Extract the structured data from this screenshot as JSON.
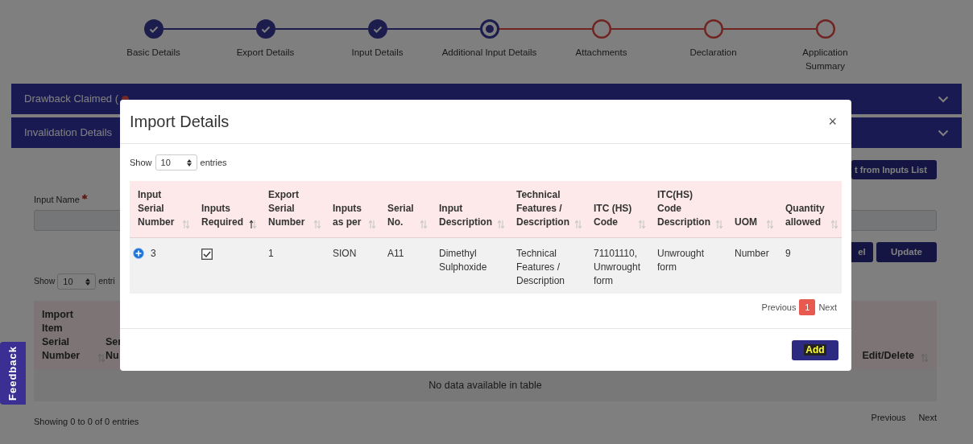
{
  "stepper": [
    {
      "label": "Basic Details",
      "completed": true,
      "current": false
    },
    {
      "label": "Export Details",
      "completed": true,
      "current": false
    },
    {
      "label": "Input Details",
      "completed": true,
      "current": false
    },
    {
      "label": "Additional Input Details",
      "completed": false,
      "current": true
    },
    {
      "label": "Attachments",
      "completed": false,
      "current": false
    },
    {
      "label": "Declaration",
      "completed": false,
      "current": false
    },
    {
      "label": "Application Summary",
      "completed": false,
      "current": false
    }
  ],
  "accordions": [
    {
      "title": "Drawback Claimed (",
      "info_icon": true
    },
    {
      "title": "Invalidation Details",
      "info_icon": false
    }
  ],
  "form": {
    "select_button": "t from Inputs List",
    "input_label": "Input Name",
    "required": true,
    "cancel_button": "el",
    "update_button": "Update",
    "show_label": "Show",
    "page_size": "10",
    "entries_label": "entri"
  },
  "items_table": {
    "columns": [
      {
        "label": "Import Item Serial Number"
      },
      {
        "label": "Ser Nu"
      },
      {
        "label": "Edit/Delete"
      }
    ],
    "empty_message": "No data available in table",
    "info": "Showing 0 to 0 of 0 entries",
    "previous": "Previous",
    "next": "Next"
  },
  "feedback_tab": "Feedback",
  "modal": {
    "title": "Import Details",
    "close": "×",
    "show_label": "Show",
    "page_size": "10",
    "entries_label": "entries",
    "columns": [
      {
        "label": "Input Serial Number",
        "sorted": false,
        "kind": "text"
      },
      {
        "label": "Inputs Required",
        "sorted": true,
        "kind": "checkbox"
      },
      {
        "label": "Export Serial Number",
        "sorted": false,
        "kind": "text"
      },
      {
        "label": "Inputs as per",
        "sorted": false,
        "kind": "text"
      },
      {
        "label": "Serial No.",
        "sorted": false,
        "kind": "text"
      },
      {
        "label": "Input Description",
        "sorted": false,
        "kind": "text"
      },
      {
        "label": "Technical Features / Description",
        "sorted": false,
        "kind": "text"
      },
      {
        "label": "ITC (HS) Code",
        "sorted": false,
        "kind": "text"
      },
      {
        "label": "ITC(HS) Code Description",
        "sorted": false,
        "kind": "text"
      },
      {
        "label": "UOM",
        "sorted": false,
        "kind": "text"
      },
      {
        "label": "Quantity allowed",
        "sorted": false,
        "kind": "text"
      }
    ],
    "rows": [
      {
        "expandable": true,
        "cells": [
          "3",
          true,
          "1",
          "SION",
          "A11",
          "Dimethyl Sulphoxide",
          "Technical Features / Description",
          "71101110, Unwrought form",
          "Unwrought form",
          "Number",
          "9"
        ]
      }
    ],
    "pagination": {
      "previous": "Previous",
      "pages": [
        {
          "label": "1",
          "selected": true
        }
      ],
      "next": "Next"
    },
    "add_button": "Add"
  }
}
